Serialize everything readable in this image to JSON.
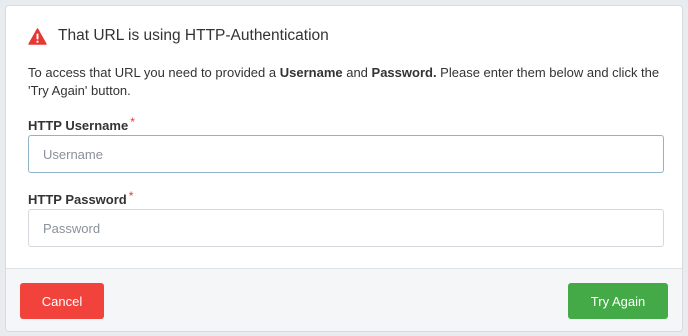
{
  "dialog": {
    "title": "That URL is using HTTP-Authentication",
    "description": {
      "part1": "To access that URL you need to provided a ",
      "username_word": "Username",
      "part2": " and ",
      "password_word": "Password.",
      "part3": " Please enter them below and click the 'Try Again' button."
    },
    "icon": "warning-triangle-icon",
    "accent_colors": {
      "warning": "#e53935",
      "cancel": "#f2423c",
      "try_again": "#43aa47"
    }
  },
  "form": {
    "username": {
      "label": "HTTP Username",
      "required_mark": "*",
      "placeholder": "Username",
      "value": ""
    },
    "password": {
      "label": "HTTP Password",
      "required_mark": "*",
      "placeholder": "Password",
      "value": ""
    }
  },
  "footer": {
    "cancel_label": "Cancel",
    "try_again_label": "Try Again"
  }
}
